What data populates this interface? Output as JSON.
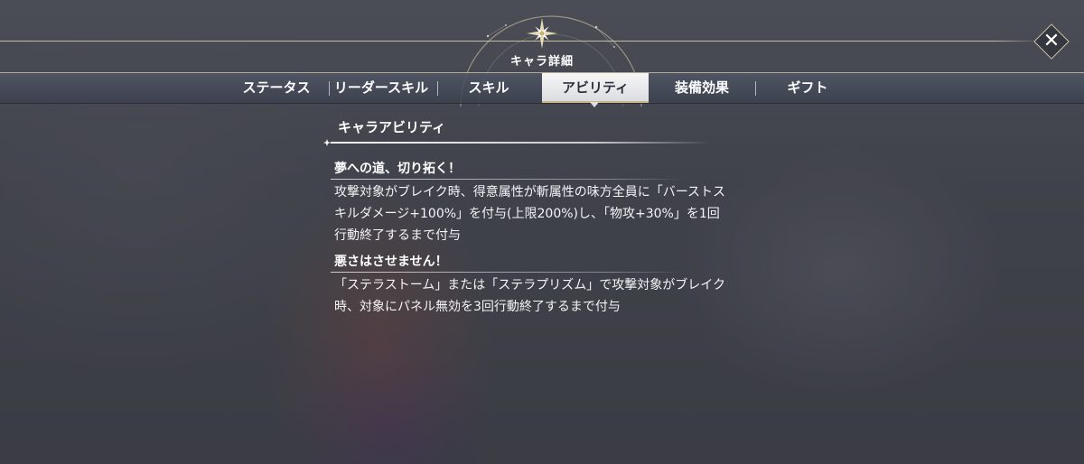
{
  "header": {
    "title": "キャラ詳細",
    "close_label": "✕"
  },
  "tabs": [
    {
      "label": "ステータス",
      "active": false
    },
    {
      "label": "リーダースキル",
      "active": false
    },
    {
      "label": "スキル",
      "active": false
    },
    {
      "label": "アビリティ",
      "active": true
    },
    {
      "label": "装備効果",
      "active": false
    },
    {
      "label": "ギフト",
      "active": false
    }
  ],
  "section": {
    "heading": "キャラアビリティ"
  },
  "abilities": [
    {
      "name": "夢への道、切り拓く！",
      "description": "攻撃対象がブレイク時、得意属性が斬属性の味方全員に「バーストス\nキルダメージ+100%」を付与(上限200%)し、「物攻+30%」を1回\n行動終了するまで付与"
    },
    {
      "name": "悪さはさせません！",
      "description": "「ステラストーム」または「ステラプリズム」で攻撃対象がブレイク\n時、対象にパネル無効を3回行動終了するまで付与"
    }
  ],
  "colors": {
    "accent_gold": "#dccdaa",
    "active_tab_bg": "#f0f0f2",
    "active_tab_text": "#2e3040",
    "text": "#ffffff"
  }
}
